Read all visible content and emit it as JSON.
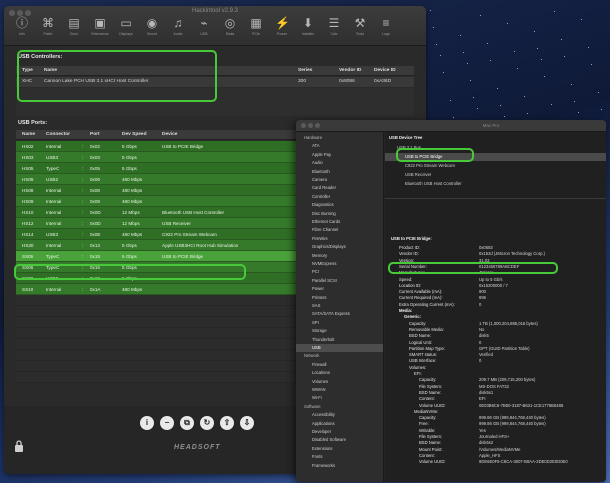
{
  "hackintool": {
    "title": "Hackintool v2.9.3",
    "toolbar": [
      {
        "label": "Info",
        "icon": "info-icon"
      },
      {
        "label": "Patch",
        "icon": "puzzle-icon"
      },
      {
        "label": "Boot",
        "icon": "boot-icon"
      },
      {
        "label": "Extensions",
        "icon": "box-icon"
      },
      {
        "label": "Displays",
        "icon": "display-icon"
      },
      {
        "label": "Sound",
        "icon": "speaker-icon"
      },
      {
        "label": "Audio",
        "icon": "audio-icon"
      },
      {
        "label": "USB",
        "icon": "usb-icon"
      },
      {
        "label": "Disks",
        "icon": "disk-icon"
      },
      {
        "label": "PCIe",
        "icon": "pcie-icon"
      },
      {
        "label": "Power",
        "icon": "power-icon"
      },
      {
        "label": "Installer",
        "icon": "installer-icon"
      },
      {
        "label": "Calc",
        "icon": "calc-icon"
      },
      {
        "label": "Tools",
        "icon": "tools-icon"
      },
      {
        "label": "Logs",
        "icon": "logs-icon"
      }
    ],
    "controllers": {
      "title": "USB Controllers:",
      "columns": [
        "Type",
        "Name",
        "Series",
        "Vendor ID",
        "Device ID"
      ],
      "rows": [
        {
          "type": "XHC",
          "name": "Cannon Lake PCH USB 3.1 xHCI Host Controller",
          "series": "300",
          "vendor": "0x8086",
          "device": "0xA36D"
        }
      ]
    },
    "ports": {
      "title": "USB Ports:",
      "columns": [
        "Name",
        "Connector",
        "Port",
        "Dev Speed",
        "Device"
      ],
      "rows": [
        {
          "name": "HS02",
          "connector": "Internal",
          "port": "0x02",
          "speed": "5 Gbps",
          "device": "USB to PCIE Bridge"
        },
        {
          "name": "HS03",
          "connector": "USB3",
          "port": "0x03",
          "speed": "5 Gbps",
          "device": ""
        },
        {
          "name": "HS05",
          "connector": "TypeC",
          "port": "0x05",
          "speed": "5 Gbps",
          "device": ""
        },
        {
          "name": "HS06",
          "connector": "USB2",
          "port": "0x06",
          "speed": "480 Mbps",
          "device": ""
        },
        {
          "name": "HS08",
          "connector": "Internal",
          "port": "0x08",
          "speed": "480 Mbps",
          "device": ""
        },
        {
          "name": "HS09",
          "connector": "Internal",
          "port": "0x09",
          "speed": "480 Mbps",
          "device": ""
        },
        {
          "name": "HS10",
          "connector": "Internal",
          "port": "0x0D",
          "speed": "12 Mbps",
          "device": "Bluetooth USB Host Controller"
        },
        {
          "name": "HS12",
          "connector": "Internal",
          "port": "0x0D",
          "speed": "12 Mbps",
          "device": "USB Receiver"
        },
        {
          "name": "HS14",
          "connector": "USB3",
          "port": "0x0E",
          "speed": "480 Mbps",
          "device": "C922 Pro Stream Webcam"
        },
        {
          "name": "HS30",
          "connector": "Internal",
          "port": "0x13",
          "speed": "5 Gbps",
          "device": "Apple USB3HCI Root Hub Simulation"
        },
        {
          "name": "SS05",
          "connector": "TypeC",
          "port": "0x15",
          "speed": "5 Gbps",
          "device": "USB to PCIE Bridge"
        },
        {
          "name": "SS06",
          "connector": "TypeC",
          "port": "0x16",
          "speed": "5 Gbps",
          "device": ""
        },
        {
          "name": "SS08",
          "connector": "USB3",
          "port": "0x18",
          "speed": "5 Gbps",
          "device": ""
        },
        {
          "name": "SS10",
          "connector": "Internal",
          "port": "0x1A",
          "speed": "480 Mbps",
          "device": ""
        }
      ]
    },
    "bottom_icons": [
      "info-icon",
      "minus-icon",
      "copy-icon",
      "refresh-icon",
      "export-icon",
      "import-icon"
    ],
    "brand": "HEADSOFT"
  },
  "sysinfo": {
    "title": "Mac Pro",
    "sidebar": [
      {
        "label": "Hardware",
        "group": true
      },
      {
        "label": "ATA"
      },
      {
        "label": "Apple Pay"
      },
      {
        "label": "Audio"
      },
      {
        "label": "Bluetooth"
      },
      {
        "label": "Camera"
      },
      {
        "label": "Card Reader"
      },
      {
        "label": "Controller"
      },
      {
        "label": "Diagnostics"
      },
      {
        "label": "Disc Burning"
      },
      {
        "label": "Ethernet Cards"
      },
      {
        "label": "Fibre Channel"
      },
      {
        "label": "FireWire"
      },
      {
        "label": "Graphics/Displays"
      },
      {
        "label": "Memory"
      },
      {
        "label": "NVMExpress"
      },
      {
        "label": "PCI"
      },
      {
        "label": "Parallel SCSI"
      },
      {
        "label": "Power"
      },
      {
        "label": "Printers"
      },
      {
        "label": "SAS"
      },
      {
        "label": "SATA/SATA Express"
      },
      {
        "label": "SPI"
      },
      {
        "label": "Storage"
      },
      {
        "label": "Thunderbolt"
      },
      {
        "label": "USB",
        "selected": true
      },
      {
        "label": "Network",
        "group": true
      },
      {
        "label": "Firewall"
      },
      {
        "label": "Locations"
      },
      {
        "label": "Volumes"
      },
      {
        "label": "WWAN"
      },
      {
        "label": "Wi-Fi"
      },
      {
        "label": "Software",
        "group": true
      },
      {
        "label": "Accessibility"
      },
      {
        "label": "Applications"
      },
      {
        "label": "Developer"
      },
      {
        "label": "Disabled Software"
      },
      {
        "label": "Extensions"
      },
      {
        "label": "Fonts"
      },
      {
        "label": "Frameworks"
      }
    ],
    "tree_title": "USB Device Tree",
    "tree": [
      {
        "label": "USB 3.1 Bus",
        "indent": 1
      },
      {
        "label": "USB to PCIE Bridge",
        "indent": 2,
        "selected": true
      },
      {
        "label": "C922 Pro Stream Webcam",
        "indent": 2
      },
      {
        "label": "USB Receiver",
        "indent": 2
      },
      {
        "label": "Bluetooth USB Host Controller",
        "indent": 2
      }
    ],
    "detail_title": "USB to PCIE Bridge:",
    "details": [
      {
        "k": "Product ID:",
        "v": "0x0583"
      },
      {
        "k": "Vendor ID:",
        "v": "0x152d  (JMicron Technology Corp.)"
      },
      {
        "k": "Version:",
        "v": "31.03"
      },
      {
        "k": "Serial Number:",
        "v": "0123456789ABCDEF"
      },
      {
        "k": "Manufacturer:",
        "v": "JMicron"
      },
      {
        "k": "Speed:",
        "v": "Up to 5 Gb/s",
        "highlight": true
      },
      {
        "k": "Location ID:",
        "v": "0x15200000 / 7"
      },
      {
        "k": "Current Available (mA):",
        "v": "900"
      },
      {
        "k": "Current Required (mA):",
        "v": "896"
      },
      {
        "k": "Extra Operating Current (mA):",
        "v": "0"
      },
      {
        "k": "Media:",
        "v": "",
        "bold": true
      },
      {
        "k": "Generic:",
        "v": "",
        "bold": true,
        "indent": 1
      },
      {
        "k": "Capacity:",
        "v": "1 TB (1,000,204,886,016 bytes)",
        "indent": 2
      },
      {
        "k": "Removable Media:",
        "v": "No",
        "indent": 2
      },
      {
        "k": "BSD Name:",
        "v": "disk5",
        "indent": 2
      },
      {
        "k": "Logical Unit:",
        "v": "0",
        "indent": 2
      },
      {
        "k": "Partition Map Type:",
        "v": "GPT (GUID Partition Table)",
        "indent": 2
      },
      {
        "k": "SMART status:",
        "v": "Verified",
        "indent": 2
      },
      {
        "k": "USB Interface:",
        "v": "0",
        "indent": 2
      },
      {
        "k": "Volumes:",
        "v": "",
        "indent": 2
      },
      {
        "k": "EFI:",
        "v": "",
        "indent": 3
      },
      {
        "k": "Capacity:",
        "v": "209.7 MB (209,715,200 bytes)",
        "indent": 4
      },
      {
        "k": "File System:",
        "v": "MS-DOS FAT32",
        "indent": 4
      },
      {
        "k": "BSD Name:",
        "v": "disk5s1",
        "indent": 4
      },
      {
        "k": "Content:",
        "v": "EFI",
        "indent": 4
      },
      {
        "k": "Volume UUID:",
        "v": "0E03B6C6-7B50-3187-B631-1CE1775B6486",
        "indent": 4
      },
      {
        "k": "MediaNVMe:",
        "v": "",
        "indent": 3
      },
      {
        "k": "Capacity:",
        "v": "999.86 GB (999,844,768,440 bytes)",
        "indent": 4
      },
      {
        "k": "Free:",
        "v": "999.86 GB (999,844,768,440 bytes)",
        "indent": 4
      },
      {
        "k": "Writable:",
        "v": "Yes",
        "indent": 4
      },
      {
        "k": "File System:",
        "v": "Journaled HFS+",
        "indent": 4
      },
      {
        "k": "BSD Name:",
        "v": "disk5s2",
        "indent": 4
      },
      {
        "k": "Mount Point:",
        "v": "/Volumes/MediaNVMe",
        "indent": 4
      },
      {
        "k": "Content:",
        "v": "Apple_HFS",
        "indent": 4
      },
      {
        "k": "Volume UUID:",
        "v": "9DE6E0F6-C8CA-3007-B8AA-2DE0D2E0D0E0",
        "indent": 4
      }
    ]
  }
}
